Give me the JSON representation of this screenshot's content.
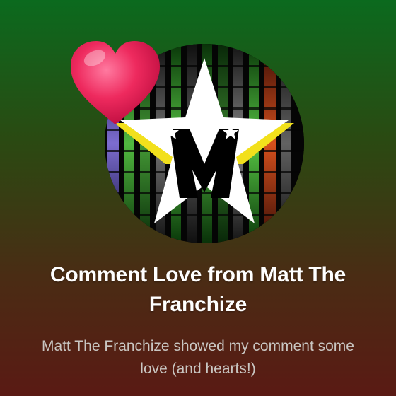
{
  "card": {
    "title": "Comment Love from Matt The Franchize",
    "subtitle": "Matt The Franchize showed my comment some love (and hearts!)"
  },
  "icons": {
    "avatar": "channel-logo-star-m",
    "badge": "heart-icon"
  },
  "colors": {
    "background_top": "#0b6a1e",
    "background_bottom": "#5a1a14",
    "title": "#ffffff",
    "subtitle": "#c9c6c2",
    "heart": "#e8164f",
    "star_white": "#ffffff",
    "star_yellow": "#f2e01c",
    "logo_letter": "#000000"
  }
}
